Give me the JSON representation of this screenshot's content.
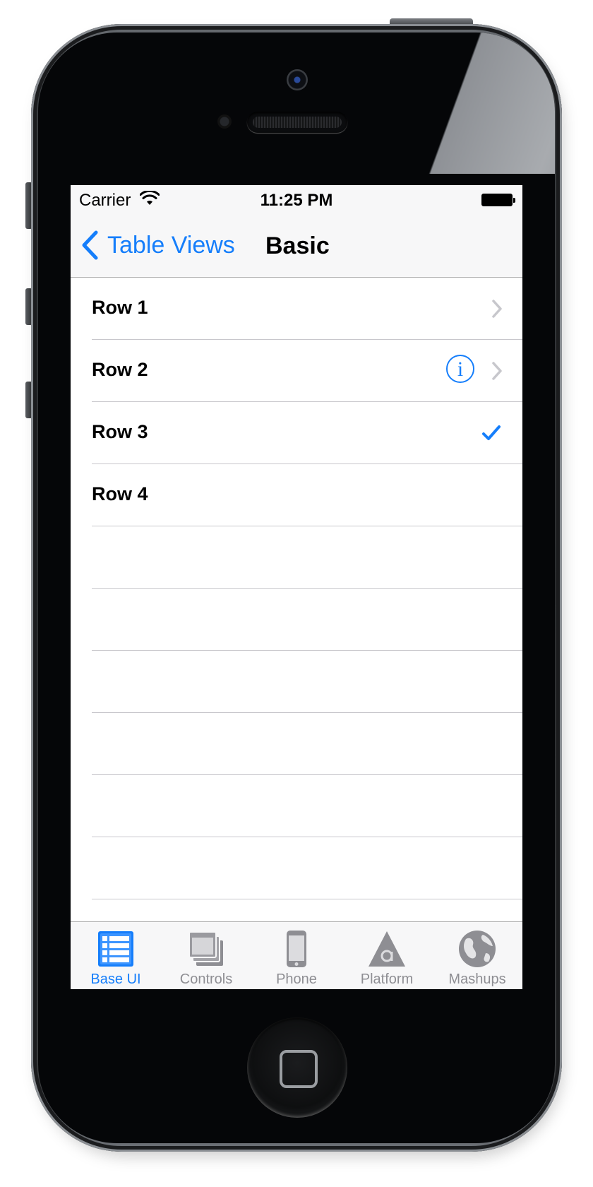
{
  "status_bar": {
    "carrier": "Carrier",
    "time": "11:25 PM",
    "wifi_icon": "wifi-icon",
    "battery_icon": "battery-full-icon"
  },
  "nav_bar": {
    "back_label": "Table Views",
    "title": "Basic"
  },
  "table": {
    "rows": [
      {
        "label": "Row 1",
        "accessory": "disclosure-chevron"
      },
      {
        "label": "Row 2",
        "accessory": "detail-disclosure (info + chevron)"
      },
      {
        "label": "Row 3",
        "accessory": "checkmark"
      },
      {
        "label": "Row 4",
        "accessory": "none"
      }
    ]
  },
  "tab_bar": {
    "selected": "Base UI",
    "tabs": [
      {
        "label": "Base UI",
        "icon": "table-list-icon"
      },
      {
        "label": "Controls",
        "icon": "stacked-windows-icon"
      },
      {
        "label": "Phone",
        "icon": "phone-icon"
      },
      {
        "label": "Platform",
        "icon": "platform-triangle-icon"
      },
      {
        "label": "Mashups",
        "icon": "globe-icon"
      }
    ]
  },
  "info_glyph": "i",
  "colors": {
    "tint": "#157efb",
    "inactive_tab": "#8e8e93",
    "bar_background": "#f7f7f8",
    "separator": "#c8c7cc"
  }
}
